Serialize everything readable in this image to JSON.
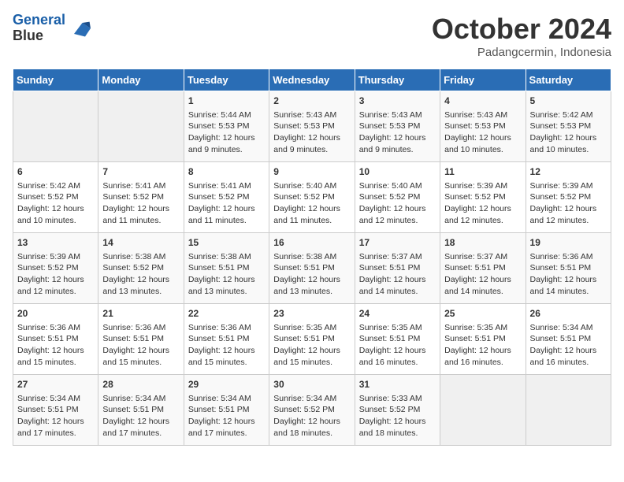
{
  "header": {
    "logo_line1": "General",
    "logo_line2": "Blue",
    "month": "October 2024",
    "location": "Padangcermin, Indonesia"
  },
  "days_of_week": [
    "Sunday",
    "Monday",
    "Tuesday",
    "Wednesday",
    "Thursday",
    "Friday",
    "Saturday"
  ],
  "weeks": [
    [
      {
        "day": "",
        "empty": true
      },
      {
        "day": "",
        "empty": true
      },
      {
        "day": "1",
        "sunrise": "Sunrise: 5:44 AM",
        "sunset": "Sunset: 5:53 PM",
        "daylight": "Daylight: 12 hours and 9 minutes."
      },
      {
        "day": "2",
        "sunrise": "Sunrise: 5:43 AM",
        "sunset": "Sunset: 5:53 PM",
        "daylight": "Daylight: 12 hours and 9 minutes."
      },
      {
        "day": "3",
        "sunrise": "Sunrise: 5:43 AM",
        "sunset": "Sunset: 5:53 PM",
        "daylight": "Daylight: 12 hours and 9 minutes."
      },
      {
        "day": "4",
        "sunrise": "Sunrise: 5:43 AM",
        "sunset": "Sunset: 5:53 PM",
        "daylight": "Daylight: 12 hours and 10 minutes."
      },
      {
        "day": "5",
        "sunrise": "Sunrise: 5:42 AM",
        "sunset": "Sunset: 5:53 PM",
        "daylight": "Daylight: 12 hours and 10 minutes."
      }
    ],
    [
      {
        "day": "6",
        "sunrise": "Sunrise: 5:42 AM",
        "sunset": "Sunset: 5:52 PM",
        "daylight": "Daylight: 12 hours and 10 minutes."
      },
      {
        "day": "7",
        "sunrise": "Sunrise: 5:41 AM",
        "sunset": "Sunset: 5:52 PM",
        "daylight": "Daylight: 12 hours and 11 minutes."
      },
      {
        "day": "8",
        "sunrise": "Sunrise: 5:41 AM",
        "sunset": "Sunset: 5:52 PM",
        "daylight": "Daylight: 12 hours and 11 minutes."
      },
      {
        "day": "9",
        "sunrise": "Sunrise: 5:40 AM",
        "sunset": "Sunset: 5:52 PM",
        "daylight": "Daylight: 12 hours and 11 minutes."
      },
      {
        "day": "10",
        "sunrise": "Sunrise: 5:40 AM",
        "sunset": "Sunset: 5:52 PM",
        "daylight": "Daylight: 12 hours and 12 minutes."
      },
      {
        "day": "11",
        "sunrise": "Sunrise: 5:39 AM",
        "sunset": "Sunset: 5:52 PM",
        "daylight": "Daylight: 12 hours and 12 minutes."
      },
      {
        "day": "12",
        "sunrise": "Sunrise: 5:39 AM",
        "sunset": "Sunset: 5:52 PM",
        "daylight": "Daylight: 12 hours and 12 minutes."
      }
    ],
    [
      {
        "day": "13",
        "sunrise": "Sunrise: 5:39 AM",
        "sunset": "Sunset: 5:52 PM",
        "daylight": "Daylight: 12 hours and 12 minutes."
      },
      {
        "day": "14",
        "sunrise": "Sunrise: 5:38 AM",
        "sunset": "Sunset: 5:52 PM",
        "daylight": "Daylight: 12 hours and 13 minutes."
      },
      {
        "day": "15",
        "sunrise": "Sunrise: 5:38 AM",
        "sunset": "Sunset: 5:51 PM",
        "daylight": "Daylight: 12 hours and 13 minutes."
      },
      {
        "day": "16",
        "sunrise": "Sunrise: 5:38 AM",
        "sunset": "Sunset: 5:51 PM",
        "daylight": "Daylight: 12 hours and 13 minutes."
      },
      {
        "day": "17",
        "sunrise": "Sunrise: 5:37 AM",
        "sunset": "Sunset: 5:51 PM",
        "daylight": "Daylight: 12 hours and 14 minutes."
      },
      {
        "day": "18",
        "sunrise": "Sunrise: 5:37 AM",
        "sunset": "Sunset: 5:51 PM",
        "daylight": "Daylight: 12 hours and 14 minutes."
      },
      {
        "day": "19",
        "sunrise": "Sunrise: 5:36 AM",
        "sunset": "Sunset: 5:51 PM",
        "daylight": "Daylight: 12 hours and 14 minutes."
      }
    ],
    [
      {
        "day": "20",
        "sunrise": "Sunrise: 5:36 AM",
        "sunset": "Sunset: 5:51 PM",
        "daylight": "Daylight: 12 hours and 15 minutes."
      },
      {
        "day": "21",
        "sunrise": "Sunrise: 5:36 AM",
        "sunset": "Sunset: 5:51 PM",
        "daylight": "Daylight: 12 hours and 15 minutes."
      },
      {
        "day": "22",
        "sunrise": "Sunrise: 5:36 AM",
        "sunset": "Sunset: 5:51 PM",
        "daylight": "Daylight: 12 hours and 15 minutes."
      },
      {
        "day": "23",
        "sunrise": "Sunrise: 5:35 AM",
        "sunset": "Sunset: 5:51 PM",
        "daylight": "Daylight: 12 hours and 15 minutes."
      },
      {
        "day": "24",
        "sunrise": "Sunrise: 5:35 AM",
        "sunset": "Sunset: 5:51 PM",
        "daylight": "Daylight: 12 hours and 16 minutes."
      },
      {
        "day": "25",
        "sunrise": "Sunrise: 5:35 AM",
        "sunset": "Sunset: 5:51 PM",
        "daylight": "Daylight: 12 hours and 16 minutes."
      },
      {
        "day": "26",
        "sunrise": "Sunrise: 5:34 AM",
        "sunset": "Sunset: 5:51 PM",
        "daylight": "Daylight: 12 hours and 16 minutes."
      }
    ],
    [
      {
        "day": "27",
        "sunrise": "Sunrise: 5:34 AM",
        "sunset": "Sunset: 5:51 PM",
        "daylight": "Daylight: 12 hours and 17 minutes."
      },
      {
        "day": "28",
        "sunrise": "Sunrise: 5:34 AM",
        "sunset": "Sunset: 5:51 PM",
        "daylight": "Daylight: 12 hours and 17 minutes."
      },
      {
        "day": "29",
        "sunrise": "Sunrise: 5:34 AM",
        "sunset": "Sunset: 5:51 PM",
        "daylight": "Daylight: 12 hours and 17 minutes."
      },
      {
        "day": "30",
        "sunrise": "Sunrise: 5:34 AM",
        "sunset": "Sunset: 5:52 PM",
        "daylight": "Daylight: 12 hours and 18 minutes."
      },
      {
        "day": "31",
        "sunrise": "Sunrise: 5:33 AM",
        "sunset": "Sunset: 5:52 PM",
        "daylight": "Daylight: 12 hours and 18 minutes."
      },
      {
        "day": "",
        "empty": true
      },
      {
        "day": "",
        "empty": true
      }
    ]
  ]
}
